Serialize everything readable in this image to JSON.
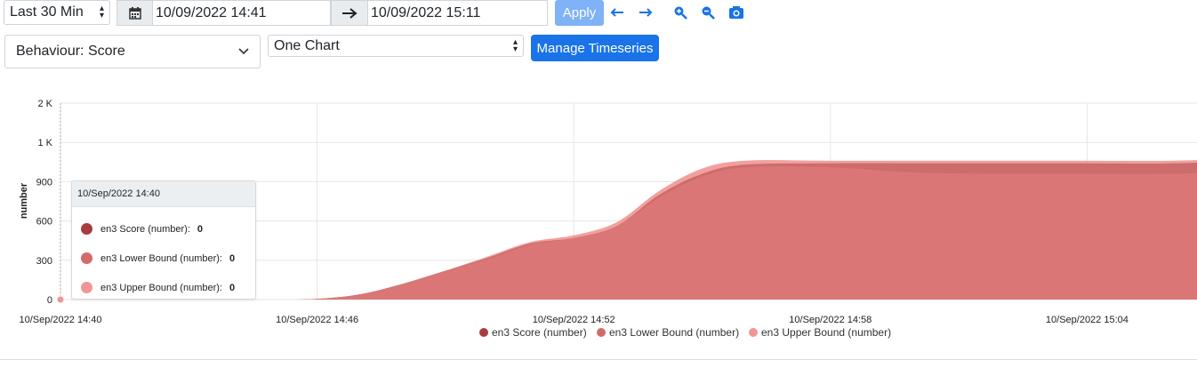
{
  "toolbar": {
    "range_select": "Last 30 Min",
    "start_value": "10/09/2022 14:41",
    "end_value": "10/09/2022 15:11",
    "apply_label": "Apply"
  },
  "controls": {
    "behaviour_select": "Behaviour: Score",
    "chart_mode_select": "One Chart",
    "manage_label": "Manage Timeseries"
  },
  "colors": {
    "score": "#a83b3f",
    "lower": "#d36a6a",
    "upper": "#f19693",
    "accent": "#1a73e8"
  },
  "tooltip": {
    "title": "10/Sep/2022 14:40",
    "rows": [
      {
        "label": "en3 Score (number):",
        "value": "0"
      },
      {
        "label": "en3 Lower Bound (number):",
        "value": "0"
      },
      {
        "label": "en3 Upper Bound (number):",
        "value": "0"
      }
    ]
  },
  "chart_data": {
    "type": "area",
    "title": "",
    "xlabel": "",
    "ylabel": "number",
    "x_ticks": [
      "10/Sep/2022 14:40",
      "10/Sep/2022 14:46",
      "10/Sep/2022 14:52",
      "10/Sep/2022 14:58",
      "10/Sep/2022 15:04"
    ],
    "y_ticks": [
      "0",
      "300",
      "600",
      "900",
      "1 K",
      "2 K"
    ],
    "y_tick_values": [
      0,
      300,
      600,
      900,
      1200,
      1500
    ],
    "ylim": [
      0,
      1500
    ],
    "x_minutes": [
      0,
      2,
      4,
      5,
      6,
      7,
      8,
      9,
      10,
      11,
      12,
      13,
      14,
      15,
      16,
      18,
      20,
      22,
      24,
      26,
      27.9
    ],
    "grid": true,
    "legend_position": "bottom",
    "series": [
      {
        "name": "en3 Score (number)",
        "values": [
          0,
          0,
          0,
          0,
          5,
          40,
          120,
          220,
          320,
          430,
          470,
          560,
          800,
          960,
          1030,
          1040,
          1040,
          1040,
          1040,
          1040,
          1065
        ]
      },
      {
        "name": "en3 Lower Bound (number)",
        "values": [
          0,
          0,
          0,
          0,
          5,
          40,
          120,
          220,
          310,
          420,
          470,
          560,
          780,
          940,
          1010,
          1010,
          970,
          960,
          960,
          960,
          980
        ]
      },
      {
        "name": "en3 Upper Bound (number)",
        "values": [
          0,
          0,
          0,
          0,
          5,
          40,
          120,
          220,
          330,
          440,
          490,
          590,
          830,
          1000,
          1060,
          1060,
          1060,
          1060,
          1060,
          1060,
          1080
        ]
      }
    ]
  }
}
